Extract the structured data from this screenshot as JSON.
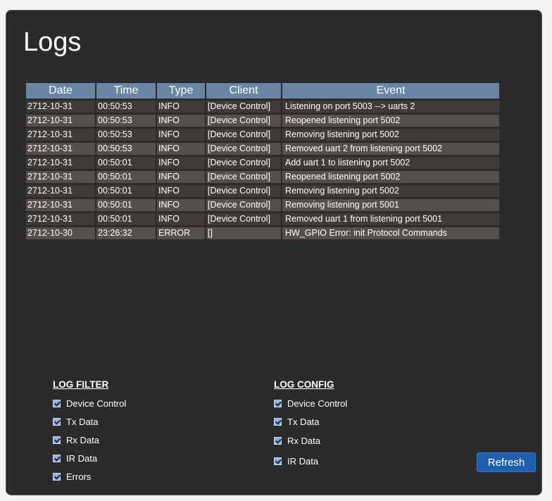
{
  "page": {
    "title": "Logs"
  },
  "table": {
    "columns": [
      "Date",
      "Time",
      "Type",
      "Client",
      "Event"
    ],
    "rows": [
      [
        "2712-10-31",
        "00:50:53",
        "INFO",
        "[Device Control]",
        "Listening on port 5003 --> uarts 2"
      ],
      [
        "2712-10-31",
        "00:50:53",
        "INFO",
        "[Device Control]",
        "Reopened listening port 5002"
      ],
      [
        "2712-10-31",
        "00:50:53",
        "INFO",
        "[Device Control]",
        "Removing listening port 5002"
      ],
      [
        "2712-10-31",
        "00:50:53",
        "INFO",
        "[Device Control]",
        "Removed uart 2 from listening port 5002"
      ],
      [
        "2712-10-31",
        "00:50:01",
        "INFO",
        "[Device Control]",
        "Add uart 1 to listening port 5002"
      ],
      [
        "2712-10-31",
        "00:50:01",
        "INFO",
        "[Device Control]",
        "Reopened listening port 5002"
      ],
      [
        "2712-10-31",
        "00:50:01",
        "INFO",
        "[Device Control]",
        "Removing listening port 5002"
      ],
      [
        "2712-10-31",
        "00:50:01",
        "INFO",
        "[Device Control]",
        "Removing listening port 5001"
      ],
      [
        "2712-10-31",
        "00:50:01",
        "INFO",
        "[Device Control]",
        "Removed uart 1 from listening port 5001"
      ],
      [
        "2712-10-30",
        "23:26:32",
        "ERROR",
        "[]",
        "HW_GPIO Error: init Protocol Commands"
      ]
    ]
  },
  "log_filter": {
    "heading": "LOG FILTER",
    "items": [
      {
        "label": "Device Control",
        "checked": true
      },
      {
        "label": "Tx Data",
        "checked": true
      },
      {
        "label": "Rx Data",
        "checked": true
      },
      {
        "label": "IR Data",
        "checked": true
      },
      {
        "label": "Errors",
        "checked": true
      }
    ]
  },
  "log_config": {
    "heading": "LOG CONFIG",
    "items": [
      {
        "label": "Device Control",
        "checked": true
      },
      {
        "label": "Tx Data",
        "checked": true
      },
      {
        "label": "Rx Data",
        "checked": true
      },
      {
        "label": "IR Data",
        "checked": true
      }
    ]
  },
  "buttons": {
    "refresh": "Refresh"
  },
  "colors": {
    "panel_bg": "#2b2b2b",
    "header_bg": "#6b86a4",
    "row_odd": "#3e3b39",
    "row_even": "#55504b",
    "button_bg": "#1f5fb0"
  }
}
